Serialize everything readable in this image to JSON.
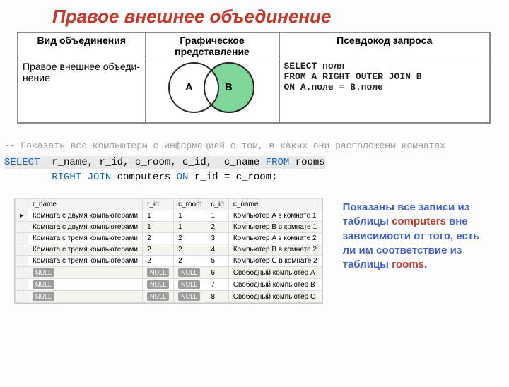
{
  "title": "Правое внешнее объединение",
  "join_table": {
    "headers": {
      "type": "Вид объединения",
      "vis": "Графическое представление",
      "code": "Псевдокод запроса"
    },
    "row": {
      "name": "Правое внешнее объеди-\nнение",
      "venn": {
        "a": "A",
        "b": "B"
      },
      "code": "SELECT поля\nFROM A RIGHT OUTER JOIN B\nON A.поле = B.поле"
    }
  },
  "sql": {
    "comment": "-- Показать все компьютеры с информацией о том, в каких они расположены комнатах",
    "line1": {
      "kw": "SELECT",
      "rest": "  r_name, r_id, c_room, c_id,  c_name ",
      "kw2": "FROM",
      "rest2": " rooms"
    },
    "line2": {
      "indent": "        ",
      "kw": "RIGHT JOIN",
      "mid": " computers ",
      "kw2": "ON",
      "rest": " r_id = c_room;"
    }
  },
  "results": {
    "columns": [
      "r_name",
      "r_id",
      "c_room",
      "c_id",
      "c_name"
    ],
    "rows": [
      {
        "r_name": "Комната с двумя компьютерами",
        "r_id": "1",
        "c_room": "1",
        "c_id": "1",
        "c_name": "Компьютер A в комнате 1"
      },
      {
        "r_name": "Комната с двумя компьютерами",
        "r_id": "1",
        "c_room": "1",
        "c_id": "2",
        "c_name": "Компьютер B в комнате 1"
      },
      {
        "r_name": "Комната с тремя компьютерами",
        "r_id": "2",
        "c_room": "2",
        "c_id": "3",
        "c_name": "Компьютер A в комнате 2"
      },
      {
        "r_name": "Комната с тремя компьютерами",
        "r_id": "2",
        "c_room": "2",
        "c_id": "4",
        "c_name": "Компьютер B в комнате 2"
      },
      {
        "r_name": "Комната с тремя компьютерами",
        "r_id": "2",
        "c_room": "2",
        "c_id": "5",
        "c_name": "Компьютер C в комнате 2"
      },
      {
        "r_name": null,
        "r_id": null,
        "c_room": null,
        "c_id": "6",
        "c_name": "Свободный компьютер A"
      },
      {
        "r_name": null,
        "r_id": null,
        "c_room": null,
        "c_id": "7",
        "c_name": "Свободный компьютер B"
      },
      {
        "r_name": null,
        "r_id": null,
        "c_room": null,
        "c_id": "8",
        "c_name": "Свободный компьютер C"
      }
    ],
    "null_label": "NULL"
  },
  "caption": {
    "p1": "Показаны все записи из таблицы",
    "t1": "computers",
    "p2": "вне зависимости от того, есть ли им соответствие из таблицы",
    "t2": "rooms."
  }
}
